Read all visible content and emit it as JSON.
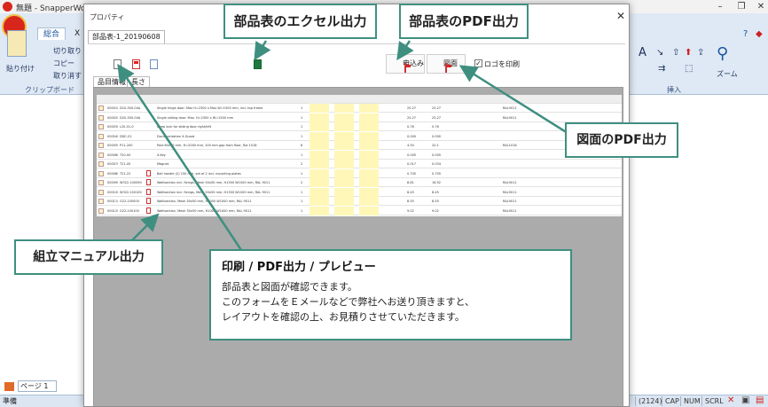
{
  "app": {
    "title": "無題 - SnapperWorks",
    "ribbon_tabs": [
      "総合",
      "X"
    ],
    "clipboard": {
      "paste": "貼り付け",
      "cut": "切り取り",
      "copy": "コピー",
      "undo": "取り消す",
      "group_label": "クリップボード"
    },
    "insert_group": "挿入",
    "zoom_label": "ズーム",
    "page_tab": "ページ 1",
    "status": {
      "ready": "準備",
      "cap": "CAP",
      "num": "NUM",
      "scrl": "SCRL",
      "coord": "(2124)"
    }
  },
  "dialog": {
    "title": "プロパティ",
    "doc_tab": "部品表-1_20190608",
    "buttons": {
      "order": "申込み",
      "drawing": "図面",
      "print_logo": "ロゴを印刷"
    },
    "subtabs": [
      "品目情報",
      "長さ"
    ],
    "table": {
      "rows": [
        {
          "code": "000010",
          "part": "D10-300-04A",
          "desc": "Single hinge door: Max H=2300 x Max W=1500 mm, incl. top frame",
          "qty": "1",
          "price": "25.27",
          "total": "25.27",
          "color": "RAL9011"
        },
        {
          "code": "000020",
          "part": "D20-300-04A",
          "desc": "Single sliding door: Max. H=2300 x W=1500 mm",
          "qty": "1",
          "price": "25.27",
          "total": "25.27",
          "color": "RAL9011"
        },
        {
          "code": "000030",
          "part": "L20-01-0",
          "desc": "Deep lock for sliding door right/left",
          "qty": "1",
          "price": "0.76",
          "total": "0.76",
          "color": ""
        },
        {
          "code": "000040",
          "part": "DDC-01",
          "desc": "Documentation X-Guard",
          "qty": "1",
          "price": "0.000",
          "total": "0.000",
          "color": ""
        },
        {
          "code": "000050",
          "part": "P11-200",
          "desc": "Post 60x60 mm, H=2000 mm, 100 mm gap from floor, Ral 1018",
          "qty": "6",
          "price": "4.50",
          "total": "20.1",
          "color": "RAL1018"
        },
        {
          "code": "000060",
          "part": "T20-00",
          "desc": "X-Key",
          "qty": "1",
          "price": "0.005",
          "total": "0.005",
          "color": ""
        },
        {
          "code": "000070",
          "part": "T21-00",
          "desc": "Magnet",
          "qty": "2",
          "price": "0.017",
          "total": "0.034",
          "color": ""
        },
        {
          "code": "000080",
          "part": "T21-22",
          "desc": "Ball handle (2) 150 mm, set of 2 incl. mounting plates",
          "qty": "1",
          "price": "0.705",
          "total": "0.705",
          "color": ""
        },
        {
          "code": "000090",
          "part": "W322-100090",
          "desc": "Walllsection incl. fixings, Mesh 50x50 mm, H1300 W1000 mm, RAL 9011",
          "qty": "2",
          "price": "8.81",
          "total": "16.52",
          "color": "RAL9011"
        },
        {
          "code": "000100",
          "part": "W322-100100",
          "desc": "Walllsection incl. fixings, Mesh 50x50 mm, H1300 W1000 mm, RAL 9011",
          "qty": "1",
          "price": "8.45",
          "total": "8.45",
          "color": "RAL9011"
        },
        {
          "code": "000110",
          "part": "G22-100000",
          "desc": "Walllsection, Mesh 50x50 mm, H1000 W1000 mm, RAL 9011",
          "qty": "1",
          "price": "8.55",
          "total": "8.55",
          "color": "RAL9011"
        },
        {
          "code": "000120",
          "part": "G22-100100",
          "desc": "Walllsection, Mesh 50x50 mm, H1000 W1000 mm, RAL 9011",
          "qty": "1",
          "price": "9.02",
          "total": "9.02",
          "color": "RAL9011"
        }
      ]
    }
  },
  "callouts": {
    "excel": "部品表のエクセル出力",
    "pdf_parts": "部品表のPDF出力",
    "pdf_drawing": "図面のPDF出力",
    "manual": "組立マニュアル出力"
  },
  "info_box": {
    "title": "印刷 / PDF出力 / プレビュー",
    "lines": [
      "部品表と図面が確認できます。",
      "このフォームをＥメールなどで弊社へお送り頂きますと、",
      "レイアウトを確認の上、お見積りさせていただきます。"
    ]
  },
  "colors": {
    "callout_border": "#3f8f80",
    "arrow": "#3f8f80",
    "ribbon": "#dfe9f5",
    "highlight": "#fff7b8"
  }
}
